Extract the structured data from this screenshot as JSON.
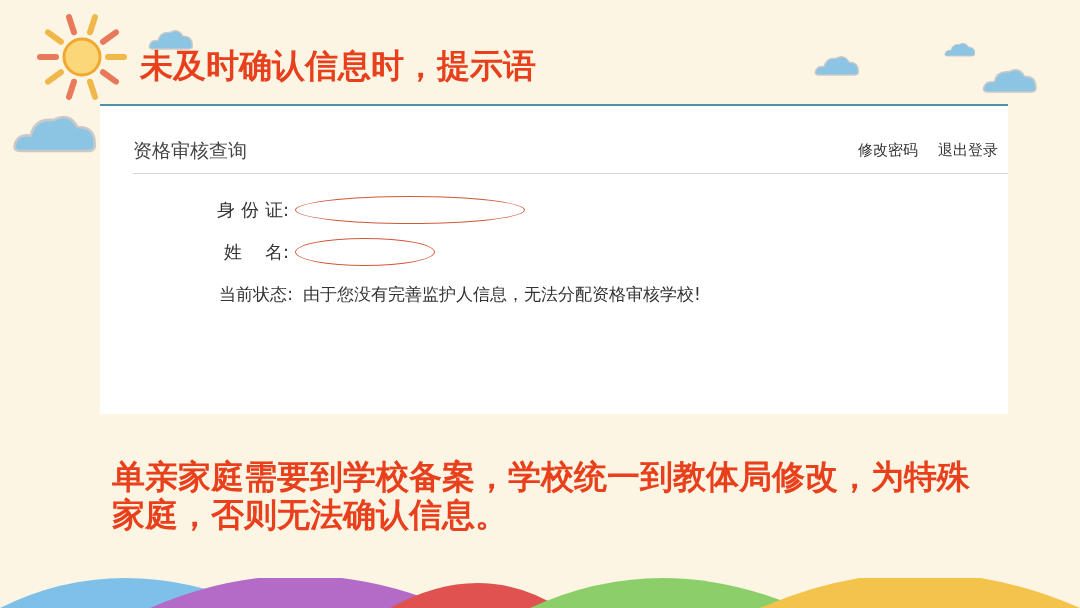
{
  "slide_title": "未及时确认信息时，提示语",
  "panel": {
    "heading": "资格审核查询",
    "links": [
      "修改密码",
      "退出登录"
    ],
    "fields": [
      {
        "label": "身 份 证:"
      },
      {
        "label": "姓    名:"
      }
    ],
    "status": {
      "label": "当前状态:",
      "value": "由于您没有完善监护人信息，无法分配资格审核学校!"
    }
  },
  "note": "单亲家庭需要到学校备案，学校统一到教体局修改，为特殊家庭，否则无法确认信息。"
}
